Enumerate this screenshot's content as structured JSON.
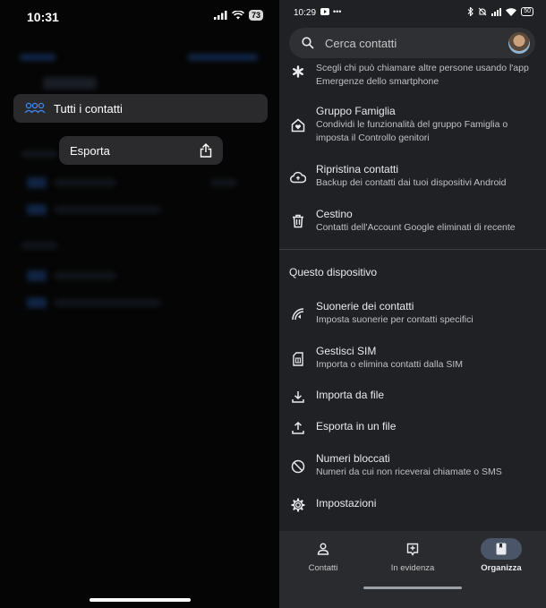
{
  "ios": {
    "time": "10:31",
    "battery": "73",
    "menu_item": {
      "label": "Tutti i contatti",
      "icon": "group-icon"
    },
    "popup": {
      "label": "Esporta",
      "icon": "share-icon"
    }
  },
  "android": {
    "status": {
      "time": "10:29",
      "battery": "50"
    },
    "search": {
      "placeholder": "Cerca contatti"
    },
    "rows": [
      {
        "title": "",
        "subtitle": "Scegli chi può chiamare altre persone usando l'app Emergenze dello smartphone",
        "icon": "emergency-asterisk-icon"
      },
      {
        "title": "Gruppo Famiglia",
        "subtitle": "Condividi le funzionalità del gruppo Famiglia o imposta il Controllo genitori",
        "icon": "family-home-icon"
      },
      {
        "title": "Ripristina contatti",
        "subtitle": "Backup dei contatti dai tuoi dispositivi Android",
        "icon": "cloud-restore-icon"
      },
      {
        "title": "Cestino",
        "subtitle": "Contatti dell'Account Google eliminati di recente",
        "icon": "trash-icon"
      }
    ],
    "section_title": "Questo dispositivo",
    "device_rows": [
      {
        "title": "Suonerie dei contatti",
        "subtitle": "Imposta suonerie per contatti specifici",
        "icon": "ringtone-icon"
      },
      {
        "title": "Gestisci SIM",
        "subtitle": "Importa o elimina contatti dalla SIM",
        "icon": "sim-card-icon"
      },
      {
        "title": "Importa da file",
        "subtitle": "",
        "icon": "download-icon"
      },
      {
        "title": "Esporta in un file",
        "subtitle": "",
        "icon": "upload-icon"
      },
      {
        "title": "Numeri bloccati",
        "subtitle": "Numeri da cui non riceverai chiamate o SMS",
        "icon": "block-icon"
      },
      {
        "title": "Impostazioni",
        "subtitle": "",
        "icon": "gear-icon"
      }
    ],
    "nav": [
      {
        "label": "Contatti",
        "icon": "person-icon",
        "active": false
      },
      {
        "label": "In evidenza",
        "icon": "highlight-icon",
        "active": false
      },
      {
        "label": "Organizza",
        "icon": "organize-icon",
        "active": true
      }
    ]
  }
}
